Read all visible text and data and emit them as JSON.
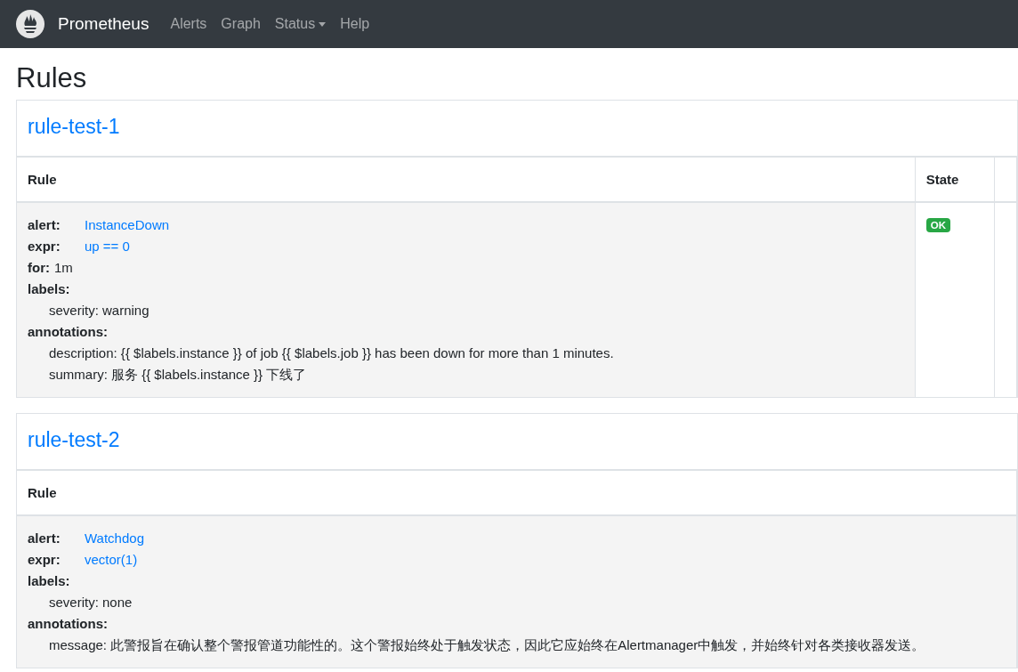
{
  "navbar": {
    "brand": "Prometheus",
    "links": [
      {
        "label": "Alerts",
        "dropdown": false
      },
      {
        "label": "Graph",
        "dropdown": false
      },
      {
        "label": "Status",
        "dropdown": true
      },
      {
        "label": "Help",
        "dropdown": false
      }
    ]
  },
  "title": "Rules",
  "groups": [
    {
      "name": "rule-test-1",
      "columns": [
        "Rule",
        "State"
      ],
      "rules": [
        {
          "alert_label": "alert:",
          "alert": "InstanceDown",
          "expr_label": "expr:",
          "expr": "up == 0",
          "for_label": "for:",
          "for": "1m",
          "labels_label": "labels:",
          "labels": [
            "severity: warning"
          ],
          "annotations_label": "annotations:",
          "annotations": [
            "description: {{ $labels.instance }} of job {{ $labels.job }} has been down for more than 1 minutes.",
            "summary: 服务 {{ $labels.instance }} 下线了"
          ],
          "state": {
            "label": "OK",
            "kind": "ok"
          }
        }
      ]
    },
    {
      "name": "rule-test-2",
      "columns": [
        "Rule"
      ],
      "rules": [
        {
          "alert_label": "alert:",
          "alert": "Watchdog",
          "expr_label": "expr:",
          "expr": "vector(1)",
          "labels_label": "labels:",
          "labels": [
            "severity: none"
          ],
          "annotations_label": "annotations:",
          "annotations": [
            "message: 此警报旨在确认整个警报管道功能性的。这个警报始终处于触发状态，因此它应始终在Alertmanager中触发，并始终针对各类接收器发送。"
          ]
        }
      ]
    }
  ]
}
